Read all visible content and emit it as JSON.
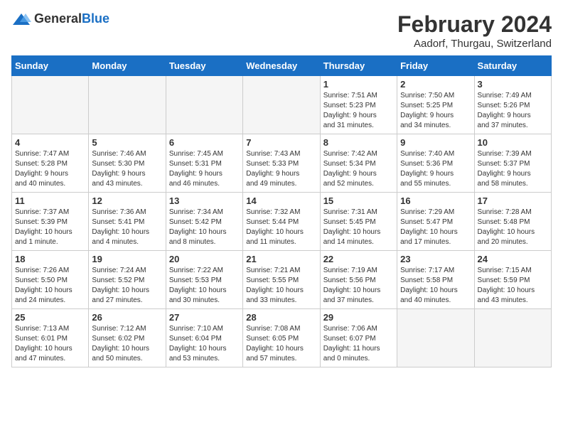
{
  "header": {
    "logo_general": "General",
    "logo_blue": "Blue",
    "month_title": "February 2024",
    "location": "Aadorf, Thurgau, Switzerland"
  },
  "weekdays": [
    "Sunday",
    "Monday",
    "Tuesday",
    "Wednesday",
    "Thursday",
    "Friday",
    "Saturday"
  ],
  "weeks": [
    [
      {
        "day": "",
        "info": ""
      },
      {
        "day": "",
        "info": ""
      },
      {
        "day": "",
        "info": ""
      },
      {
        "day": "",
        "info": ""
      },
      {
        "day": "1",
        "info": "Sunrise: 7:51 AM\nSunset: 5:23 PM\nDaylight: 9 hours\nand 31 minutes."
      },
      {
        "day": "2",
        "info": "Sunrise: 7:50 AM\nSunset: 5:25 PM\nDaylight: 9 hours\nand 34 minutes."
      },
      {
        "day": "3",
        "info": "Sunrise: 7:49 AM\nSunset: 5:26 PM\nDaylight: 9 hours\nand 37 minutes."
      }
    ],
    [
      {
        "day": "4",
        "info": "Sunrise: 7:47 AM\nSunset: 5:28 PM\nDaylight: 9 hours\nand 40 minutes."
      },
      {
        "day": "5",
        "info": "Sunrise: 7:46 AM\nSunset: 5:30 PM\nDaylight: 9 hours\nand 43 minutes."
      },
      {
        "day": "6",
        "info": "Sunrise: 7:45 AM\nSunset: 5:31 PM\nDaylight: 9 hours\nand 46 minutes."
      },
      {
        "day": "7",
        "info": "Sunrise: 7:43 AM\nSunset: 5:33 PM\nDaylight: 9 hours\nand 49 minutes."
      },
      {
        "day": "8",
        "info": "Sunrise: 7:42 AM\nSunset: 5:34 PM\nDaylight: 9 hours\nand 52 minutes."
      },
      {
        "day": "9",
        "info": "Sunrise: 7:40 AM\nSunset: 5:36 PM\nDaylight: 9 hours\nand 55 minutes."
      },
      {
        "day": "10",
        "info": "Sunrise: 7:39 AM\nSunset: 5:37 PM\nDaylight: 9 hours\nand 58 minutes."
      }
    ],
    [
      {
        "day": "11",
        "info": "Sunrise: 7:37 AM\nSunset: 5:39 PM\nDaylight: 10 hours\nand 1 minute."
      },
      {
        "day": "12",
        "info": "Sunrise: 7:36 AM\nSunset: 5:41 PM\nDaylight: 10 hours\nand 4 minutes."
      },
      {
        "day": "13",
        "info": "Sunrise: 7:34 AM\nSunset: 5:42 PM\nDaylight: 10 hours\nand 8 minutes."
      },
      {
        "day": "14",
        "info": "Sunrise: 7:32 AM\nSunset: 5:44 PM\nDaylight: 10 hours\nand 11 minutes."
      },
      {
        "day": "15",
        "info": "Sunrise: 7:31 AM\nSunset: 5:45 PM\nDaylight: 10 hours\nand 14 minutes."
      },
      {
        "day": "16",
        "info": "Sunrise: 7:29 AM\nSunset: 5:47 PM\nDaylight: 10 hours\nand 17 minutes."
      },
      {
        "day": "17",
        "info": "Sunrise: 7:28 AM\nSunset: 5:48 PM\nDaylight: 10 hours\nand 20 minutes."
      }
    ],
    [
      {
        "day": "18",
        "info": "Sunrise: 7:26 AM\nSunset: 5:50 PM\nDaylight: 10 hours\nand 24 minutes."
      },
      {
        "day": "19",
        "info": "Sunrise: 7:24 AM\nSunset: 5:52 PM\nDaylight: 10 hours\nand 27 minutes."
      },
      {
        "day": "20",
        "info": "Sunrise: 7:22 AM\nSunset: 5:53 PM\nDaylight: 10 hours\nand 30 minutes."
      },
      {
        "day": "21",
        "info": "Sunrise: 7:21 AM\nSunset: 5:55 PM\nDaylight: 10 hours\nand 33 minutes."
      },
      {
        "day": "22",
        "info": "Sunrise: 7:19 AM\nSunset: 5:56 PM\nDaylight: 10 hours\nand 37 minutes."
      },
      {
        "day": "23",
        "info": "Sunrise: 7:17 AM\nSunset: 5:58 PM\nDaylight: 10 hours\nand 40 minutes."
      },
      {
        "day": "24",
        "info": "Sunrise: 7:15 AM\nSunset: 5:59 PM\nDaylight: 10 hours\nand 43 minutes."
      }
    ],
    [
      {
        "day": "25",
        "info": "Sunrise: 7:13 AM\nSunset: 6:01 PM\nDaylight: 10 hours\nand 47 minutes."
      },
      {
        "day": "26",
        "info": "Sunrise: 7:12 AM\nSunset: 6:02 PM\nDaylight: 10 hours\nand 50 minutes."
      },
      {
        "day": "27",
        "info": "Sunrise: 7:10 AM\nSunset: 6:04 PM\nDaylight: 10 hours\nand 53 minutes."
      },
      {
        "day": "28",
        "info": "Sunrise: 7:08 AM\nSunset: 6:05 PM\nDaylight: 10 hours\nand 57 minutes."
      },
      {
        "day": "29",
        "info": "Sunrise: 7:06 AM\nSunset: 6:07 PM\nDaylight: 11 hours\nand 0 minutes."
      },
      {
        "day": "",
        "info": ""
      },
      {
        "day": "",
        "info": ""
      }
    ]
  ]
}
